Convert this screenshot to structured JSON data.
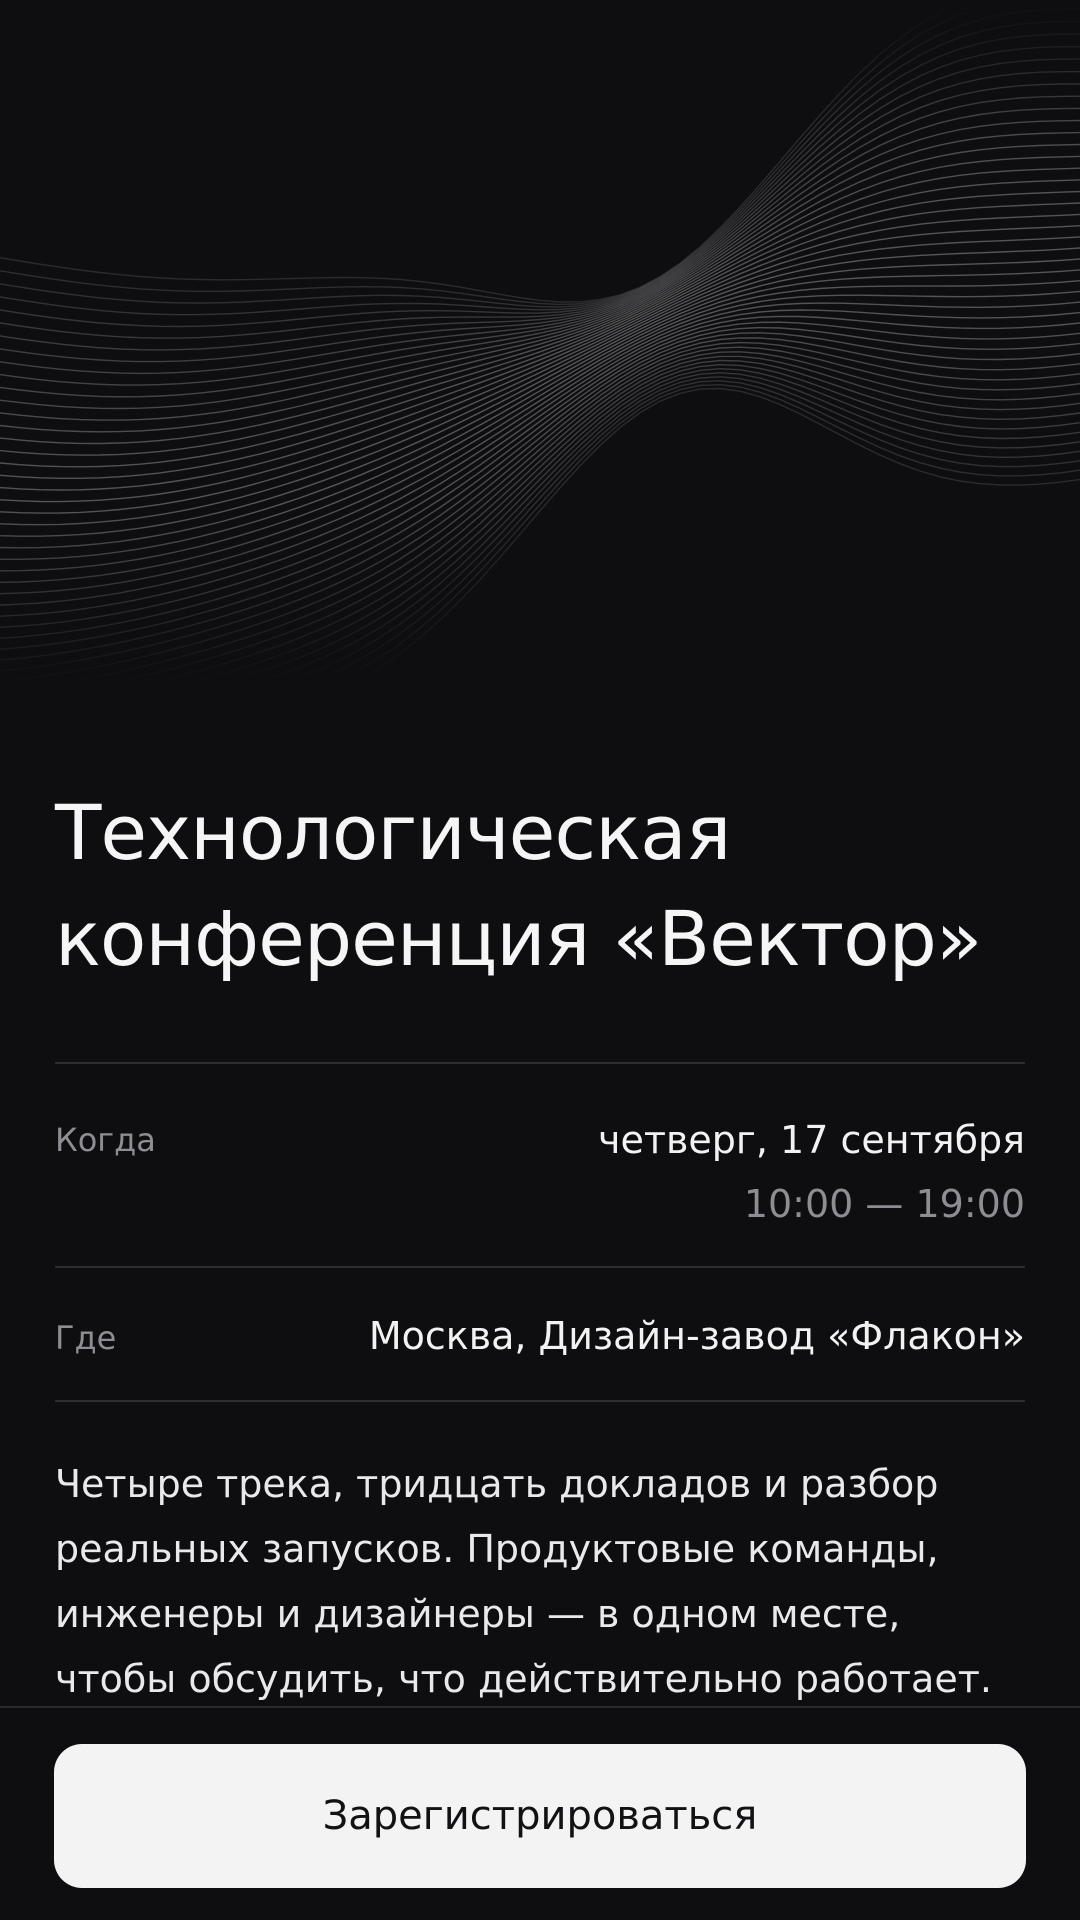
{
  "event": {
    "title_line1": "Технологическая",
    "title_line2": "конференция «Вектор»"
  },
  "details": {
    "when_label": "Когда",
    "when_date": "четверг, 17 сентября",
    "when_time": "10:00 — 19:00",
    "where_label": "Где",
    "where_value": "Москва, Дизайн-завод «Флакон»"
  },
  "description": [
    "Четыре трека, тридцать докладов и разбор",
    "реальных запусков. Продуктовые команды,",
    "инженеры и дизайнеры — в одном месте,",
    "чтобы обсудить, что действительно работает."
  ],
  "actions": {
    "register_label": "Зарегистрироваться"
  },
  "colors": {
    "background": "#0e0e10",
    "text_primary": "#f2f2f2",
    "text_secondary": "#8d8d93",
    "divider": "#2e2e32",
    "button_bg": "#f3f3f4",
    "button_text": "#121214"
  },
  "icons": {
    "hero": "wave-lines-illustration"
  }
}
